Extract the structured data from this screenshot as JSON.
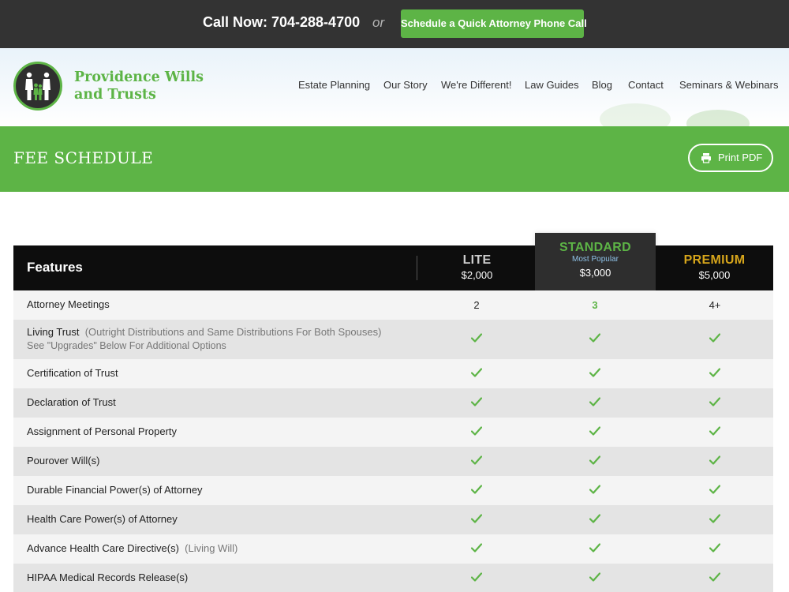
{
  "topbar": {
    "call_now": "Call Now: 704-288-4700",
    "or": "or",
    "schedule_button": "Schedule a Quick Attorney Phone Call"
  },
  "header": {
    "brand_line1": "Providence Wills",
    "brand_line2": "and Trusts",
    "nav": [
      "Estate Planning",
      "Our Story",
      "We're Different!",
      "Law Guides",
      "Blog",
      "Contact",
      "Seminars & Webinars"
    ]
  },
  "band": {
    "title": "FEE SCHEDULE",
    "print_button": "Print PDF"
  },
  "table": {
    "features_label": "Features",
    "plans": [
      {
        "name": "LITE",
        "price": "$2,000"
      },
      {
        "name": "STANDARD",
        "tag": "Most Popular",
        "price": "$3,000"
      },
      {
        "name": "PREMIUM",
        "price": "$5,000"
      }
    ],
    "rows": [
      {
        "feature": "Attorney Meetings",
        "note": "",
        "sub": "",
        "values": [
          "2",
          "3",
          "4+"
        ]
      },
      {
        "feature": "Living Trust",
        "note": "(Outright Distributions and Same Distributions For Both Spouses)",
        "sub": "See \"Upgrades\" Below For Additional Options",
        "values": [
          "check",
          "check",
          "check"
        ]
      },
      {
        "feature": "Certification of Trust",
        "note": "",
        "sub": "",
        "values": [
          "check",
          "check",
          "check"
        ]
      },
      {
        "feature": "Declaration of Trust",
        "note": "",
        "sub": "",
        "values": [
          "check",
          "check",
          "check"
        ]
      },
      {
        "feature": "Assignment of Personal Property",
        "note": "",
        "sub": "",
        "values": [
          "check",
          "check",
          "check"
        ]
      },
      {
        "feature": "Pourover Will(s)",
        "note": "",
        "sub": "",
        "values": [
          "check",
          "check",
          "check"
        ]
      },
      {
        "feature": "Durable Financial Power(s) of Attorney",
        "note": "",
        "sub": "",
        "values": [
          "check",
          "check",
          "check"
        ]
      },
      {
        "feature": "Health Care Power(s) of Attorney",
        "note": "",
        "sub": "",
        "values": [
          "check",
          "check",
          "check"
        ]
      },
      {
        "feature": "Advance Health Care Directive(s)",
        "note": "(Living Will)",
        "sub": "",
        "values": [
          "check",
          "check",
          "check"
        ]
      },
      {
        "feature": "HIPAA Medical Records Release(s)",
        "note": "",
        "sub": "",
        "values": [
          "check",
          "check",
          "check"
        ]
      }
    ]
  },
  "colors": {
    "brand_green": "#5db446",
    "premium_gold": "#d6a51b",
    "topbar_bg": "#333333",
    "popular_blue": "#8fc2e8"
  },
  "icons": {
    "logo": "family-logo-icon",
    "print": "printer-icon",
    "included": "check-icon"
  }
}
